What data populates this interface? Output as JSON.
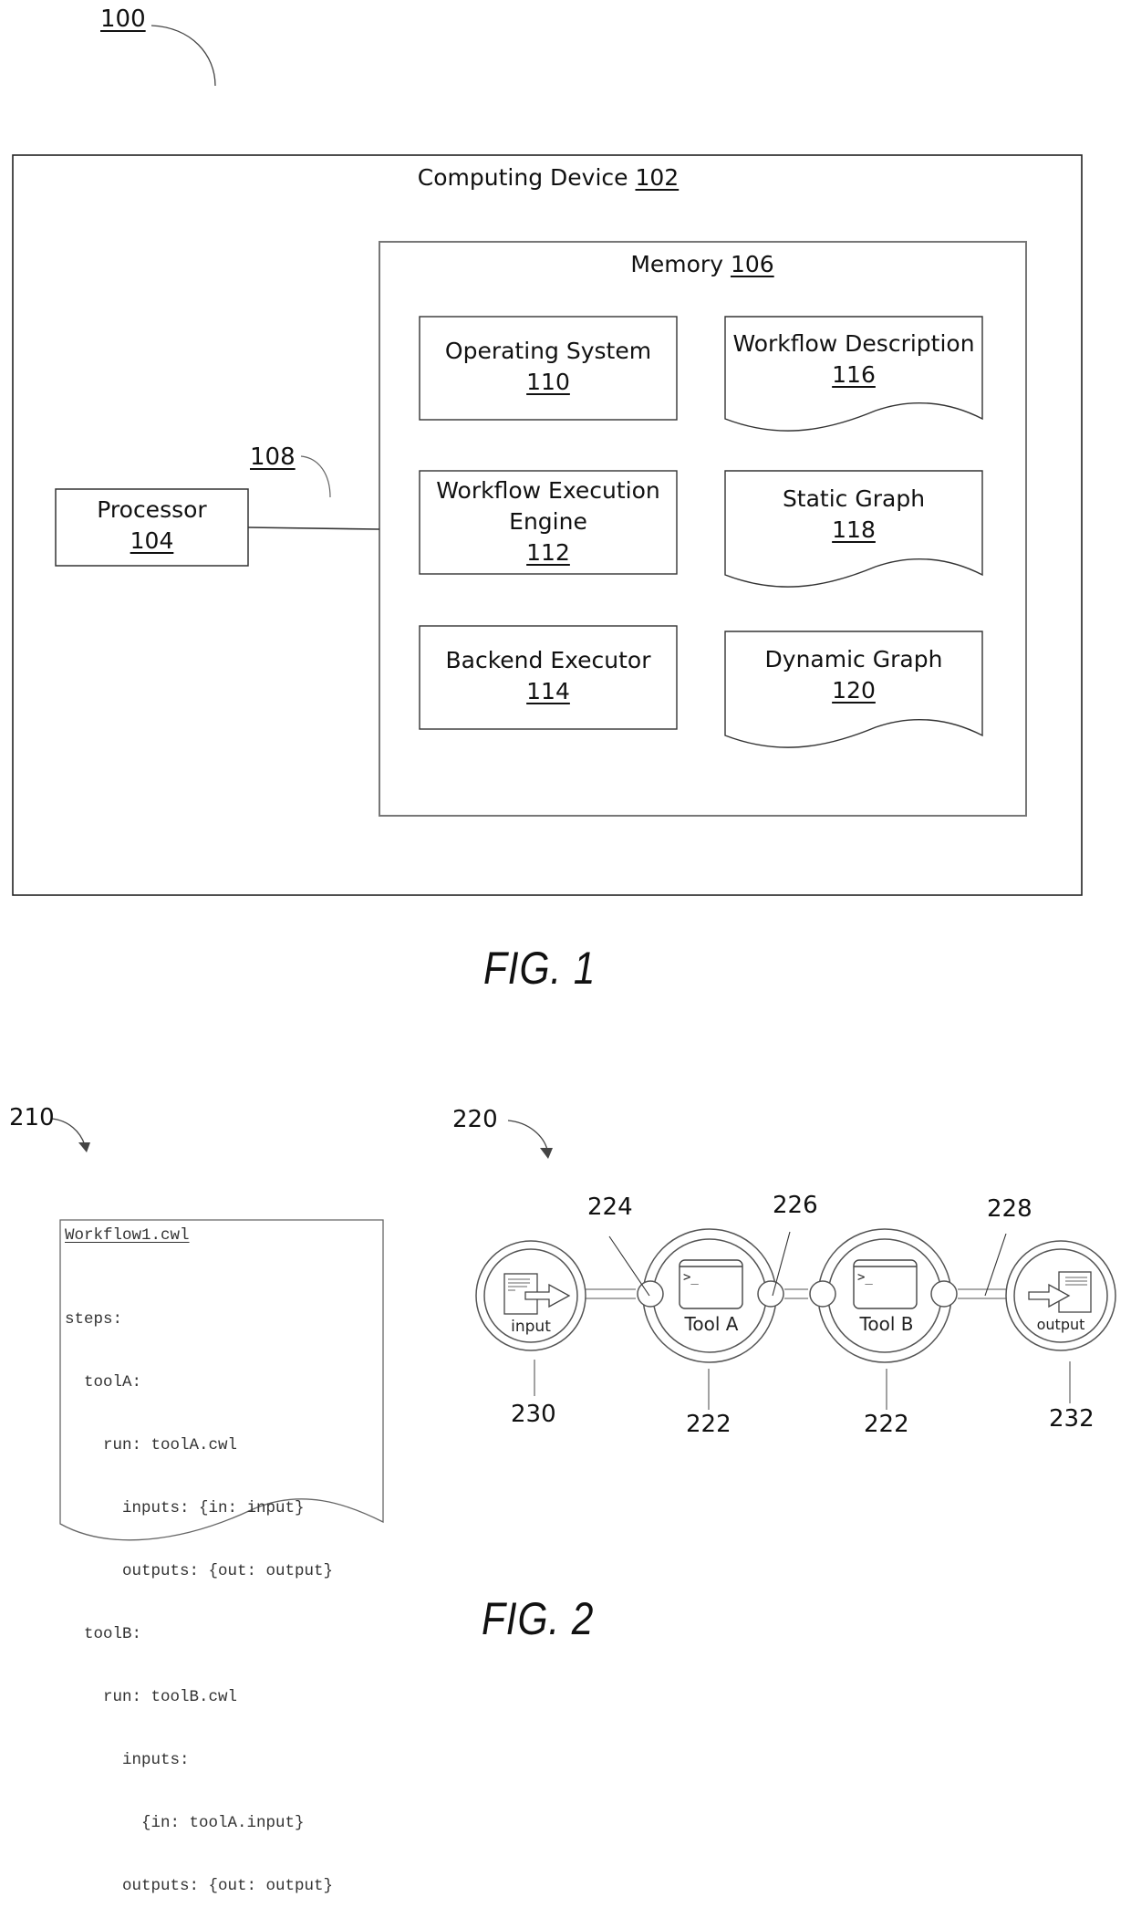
{
  "fig1": {
    "ref_label": "100",
    "caption": "FIG. 1",
    "computing_device": {
      "title": "Computing Device",
      "ref": "102"
    },
    "processor": {
      "title": "Processor",
      "ref": "104"
    },
    "bus_ref": "108",
    "memory": {
      "title": "Memory",
      "ref": "106"
    },
    "components": [
      {
        "title": "Operating System",
        "ref": "110",
        "shape": "rectangle"
      },
      {
        "title": "Workflow Execution Engine",
        "title_lines": [
          "Workflow Execution",
          "Engine"
        ],
        "ref": "112",
        "shape": "rectangle"
      },
      {
        "title": "Backend Executor",
        "ref": "114",
        "shape": "rectangle"
      },
      {
        "title": "Workflow Description",
        "ref": "116",
        "shape": "document"
      },
      {
        "title": "Static Graph",
        "ref": "118",
        "shape": "document"
      },
      {
        "title": "Dynamic Graph",
        "ref": "120",
        "shape": "document"
      }
    ]
  },
  "fig2": {
    "caption": "FIG. 2",
    "workflow_file": {
      "ref_label": "210",
      "filename": "Workflow1.cwl",
      "lines": [
        "steps:",
        "  toolA:",
        "    run: toolA.cwl",
        "      inputs: {in: input}",
        "      outputs: {out: output}",
        "  toolB:",
        "    run: toolB.cwl",
        "      inputs:",
        "        {in: toolA.input}",
        "      outputs: {out: output}"
      ]
    },
    "graph": {
      "ref_label": "220",
      "nodes": [
        {
          "id": "input",
          "label": "input",
          "ref": "230",
          "kind": "input-node",
          "icon": "document-arrow-in-icon"
        },
        {
          "id": "toolA",
          "label": "Tool A",
          "ref": "222",
          "kind": "tool-node",
          "icon": "terminal-window-icon"
        },
        {
          "id": "toolB",
          "label": "Tool B",
          "ref": "222",
          "kind": "tool-node",
          "icon": "terminal-window-icon"
        },
        {
          "id": "output",
          "label": "output",
          "ref": "232",
          "kind": "output-node",
          "icon": "arrow-into-document-icon"
        }
      ],
      "port_refs": {
        "input_port": "224",
        "output_port": "226",
        "edge": "228"
      },
      "terminal_prompt": ">_"
    }
  }
}
